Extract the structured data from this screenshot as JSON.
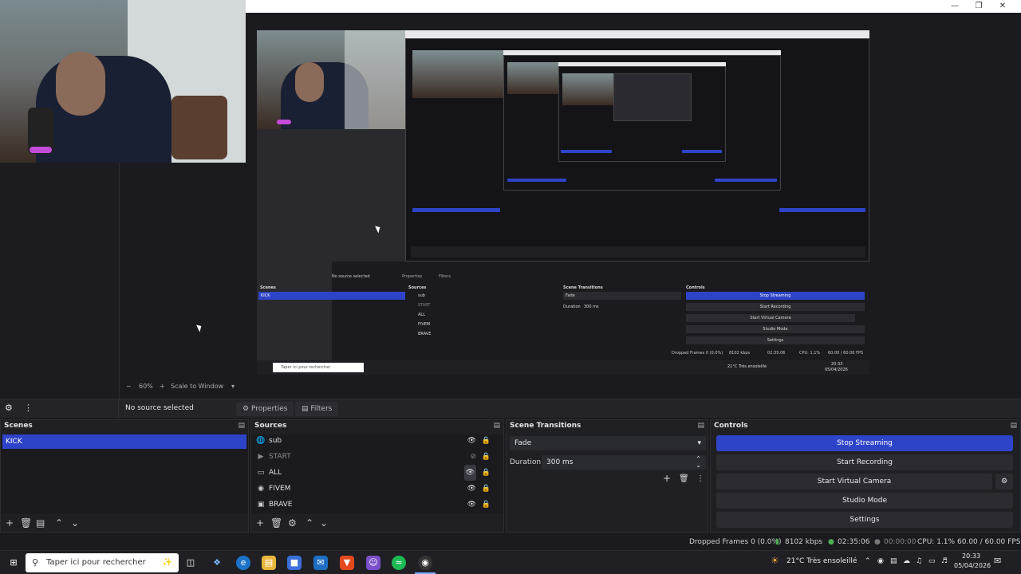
{
  "window": {
    "minimize_icon": "minimize-icon",
    "maximize_icon": "maximize-icon",
    "close_icon": "close-icon"
  },
  "preview": {
    "zoom_minus": "−",
    "zoom_level": "60%",
    "zoom_plus": "+",
    "scale_mode": "Scale to Window",
    "nested_no_source": "No source selected",
    "nested_properties": "Properties",
    "nested_filters": "Filters",
    "nested_scenes": "Scenes",
    "nested_sources": "Sources",
    "nested_transitions": "Scene Transitions",
    "nested_controls": "Controls",
    "nested_kick": "KICK",
    "nested_src": [
      "sub",
      "START",
      "ALL",
      "FIVEM",
      "BRAVE"
    ],
    "nested_fade": "Fade",
    "nested_duration": "Duration",
    "nested_duration_val": "300 ms",
    "nested_btns": [
      "Stop Streaming",
      "Start Recording",
      "Start Virtual Camera",
      "Studio Mode",
      "Settings"
    ],
    "nested_status": "Dropped Frames 0 (0.0%)",
    "nested_kbps": "8102 kbps",
    "nested_time": "02:35:06",
    "nested_cpu": "CPU: 1.1%",
    "nested_fps": "60.00 / 60.00 FPS",
    "nested_search": "Taper ici pour rechercher",
    "nested_weather": "21°C Très ensoleillé",
    "nested_clock_time": "20:33",
    "nested_clock_date": "05/04/2026"
  },
  "toolbar": {
    "no_source": "No source selected",
    "properties": "Properties",
    "filters": "Filters"
  },
  "scenes": {
    "title": "Scenes",
    "items": [
      "KICK"
    ]
  },
  "sources": {
    "title": "Sources",
    "items": [
      {
        "name": "sub",
        "icon": "globe-icon"
      },
      {
        "name": "START",
        "icon": "play-icon"
      },
      {
        "name": "ALL",
        "icon": "monitor-icon"
      },
      {
        "name": "FIVEM",
        "icon": "gamepad-icon"
      },
      {
        "name": "BRAVE",
        "icon": "window-icon"
      }
    ]
  },
  "transitions": {
    "title": "Scene Transitions",
    "selected": "Fade",
    "duration_label": "Duration",
    "duration_value": "300 ms"
  },
  "controls": {
    "title": "Controls",
    "stop_streaming": "Stop Streaming",
    "start_recording": "Start Recording",
    "start_virtual_camera": "Start Virtual Camera",
    "studio_mode": "Studio Mode",
    "settings": "Settings"
  },
  "status": {
    "dropped_frames": "Dropped Frames 0 (0.0%)",
    "bitrate": "8102 kbps",
    "stream_time": "02:35:06",
    "rec_time": "00:00:00",
    "cpu": "CPU: 1.1%",
    "fps": "60.00 / 60.00 FPS"
  },
  "taskbar": {
    "search_placeholder": "Taper ici pour rechercher",
    "weather": "21°C  Très ensoleillé",
    "time": "20:33",
    "date": "05/04/2026"
  },
  "colors": {
    "accent": "#2e44c8",
    "panel": "#1f1f24",
    "background": "#1b1b1f"
  }
}
